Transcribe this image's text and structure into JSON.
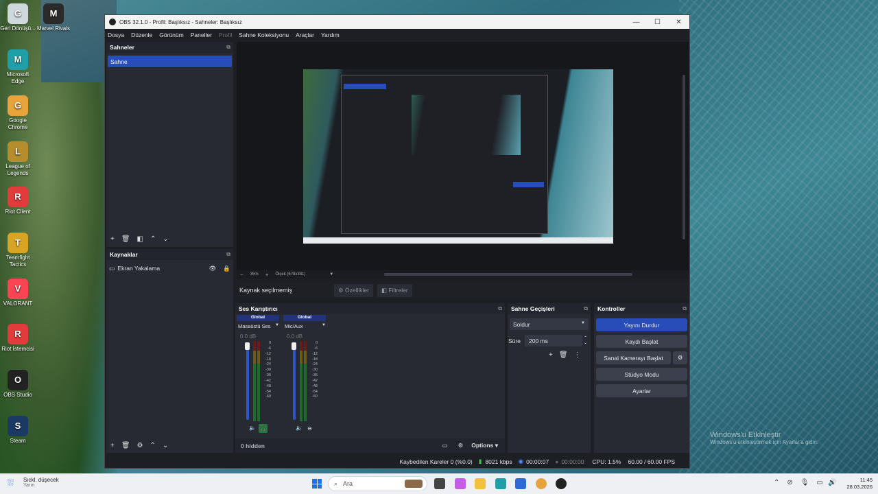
{
  "desktop": {
    "icons": [
      {
        "label": "Geri Dönüşü...",
        "icon": "recycle-bin-icon",
        "color": "#cfd8dc"
      },
      {
        "label": "Marvel Rivals",
        "icon": "marvel-rivals-icon",
        "color": "#2a2a2a"
      },
      {
        "label": "Microsoft Edge",
        "icon": "edge-icon",
        "color": "#1fa0a8"
      },
      {
        "label": "Google Chrome",
        "icon": "chrome-icon",
        "color": "#e8a33a"
      },
      {
        "label": "League of Legends",
        "icon": "league-icon",
        "color": "#b58d2c"
      },
      {
        "label": "Riot Client",
        "icon": "riot-icon",
        "color": "#e23b3b"
      },
      {
        "label": "Teamfight Tactics",
        "icon": "tft-icon",
        "color": "#d8a423"
      },
      {
        "label": "VALORANT",
        "icon": "valorant-icon",
        "color": "#fa4454"
      },
      {
        "label": "Riot İstemcisi",
        "icon": "riot-icon",
        "color": "#e23b3b"
      },
      {
        "label": "OBS Studio",
        "icon": "obs-icon",
        "color": "#222"
      },
      {
        "label": "Steam",
        "icon": "steam-icon",
        "color": "#1b3a63"
      }
    ],
    "watermark_line1": "Windows'u Etkinleştir",
    "watermark_line2": "Windows'u etkinleştirmek için Ayarlar'a gidin."
  },
  "window": {
    "title": "OBS 32.1.0 - Profil: Başlıksız - Sahneler: Başlıksız",
    "controls": {
      "minimize": "—",
      "maximize": "☐",
      "close": "✕"
    }
  },
  "menu": [
    "Dosya",
    "Düzenle",
    "Görünüm",
    "Paneller",
    "Profil",
    "Sahne Koleksiyonu",
    "Araçlar",
    "Yardım"
  ],
  "scenes": {
    "title": "Sahneler",
    "items": [
      "Sahne"
    ]
  },
  "sources": {
    "title": "Kaynaklar",
    "items": [
      "Ekran Yakalama"
    ]
  },
  "preview": {
    "zoom": "35%",
    "scale_label": "Ölçek (678x381)"
  },
  "source_bar": {
    "status": "Kaynak seçilmemiş",
    "properties": "Özellikler",
    "filters": "Filtreler"
  },
  "mixer": {
    "title": "Ses Karıştırıcı",
    "channels": [
      {
        "badge": "Global",
        "name": "Masaüstü Ses",
        "db": "0.0 dB"
      },
      {
        "badge": "Global",
        "name": "Mic/Aux",
        "db": "0.0 dB"
      }
    ],
    "scale": [
      "0",
      "-6",
      "-12",
      "-18",
      "-24",
      "-30",
      "-36",
      "-42",
      "-48",
      "-54",
      "-60"
    ],
    "hidden": "0 hidden",
    "options": "Options"
  },
  "transitions": {
    "title": "Sahne Geçişleri",
    "selected": "Soldur",
    "duration_label": "Süre",
    "duration_value": "200 ms"
  },
  "controls": {
    "title": "Kontroller",
    "stop_stream": "Yayını Durdur",
    "start_record": "Kaydı Başlat",
    "virtual_cam": "Sanal Kamerayı Başlat",
    "studio_mode": "Stüdyo Modu",
    "settings": "Ayarlar"
  },
  "statusbar": {
    "dropped": "Kaybedilen Kareler 0 (%0.0)",
    "bitrate": "8021 kbps",
    "stream_time": "00:00:07",
    "rec_time": "00:00:00",
    "cpu": "CPU: 1.5%",
    "fps": "60.00 / 60.00 FPS"
  },
  "taskbar": {
    "weather_title": "Sıckl. düşecek",
    "weather_sub": "Yarın",
    "search": "Ara",
    "time": "11:45",
    "date": "28.03.2026"
  }
}
